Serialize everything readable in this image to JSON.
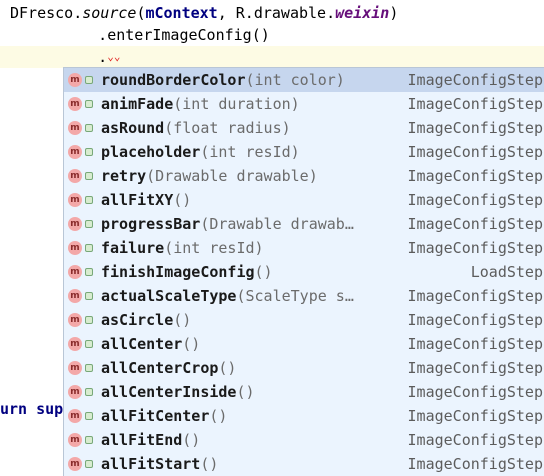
{
  "editor": {
    "line1_obj": "DFresco.",
    "line1_method": "source",
    "line1_open": "(",
    "line1_arg1": "mContext",
    "line1_sep": ", R.drawable.",
    "line1_field": "weixin",
    "line1_close": ")",
    "line2": "      .enterImageConfig()",
    "line3": "      .",
    "fragment": "urn sup"
  },
  "completion": {
    "items": [
      {
        "name": "roundBorderColor",
        "params": "(int color)",
        "type": "ImageConfigStep"
      },
      {
        "name": "animFade",
        "params": "(int duration)",
        "type": "ImageConfigStep"
      },
      {
        "name": "asRound",
        "params": "(float radius)",
        "type": "ImageConfigStep"
      },
      {
        "name": "placeholder",
        "params": "(int resId)",
        "type": "ImageConfigStep"
      },
      {
        "name": "retry",
        "params": "(Drawable drawable)",
        "type": "ImageConfigStep"
      },
      {
        "name": "allFitXY",
        "params": "()",
        "type": "ImageConfigStep"
      },
      {
        "name": "progressBar",
        "params": "(Drawable drawab…",
        "type": "ImageConfigStep"
      },
      {
        "name": "failure",
        "params": "(int resId)",
        "type": "ImageConfigStep"
      },
      {
        "name": "finishImageConfig",
        "params": "()",
        "type": "LoadStep"
      },
      {
        "name": "actualScaleType",
        "params": "(ScaleType s…",
        "type": "ImageConfigStep"
      },
      {
        "name": "asCircle",
        "params": "()",
        "type": "ImageConfigStep"
      },
      {
        "name": "allCenter",
        "params": "()",
        "type": "ImageConfigStep"
      },
      {
        "name": "allCenterCrop",
        "params": "()",
        "type": "ImageConfigStep"
      },
      {
        "name": "allCenterInside",
        "params": "()",
        "type": "ImageConfigStep"
      },
      {
        "name": "allFitCenter",
        "params": "()",
        "type": "ImageConfigStep"
      },
      {
        "name": "allFitEnd",
        "params": "()",
        "type": "ImageConfigStep"
      },
      {
        "name": "allFitStart",
        "params": "()",
        "type": "ImageConfigStep"
      }
    ],
    "method_icon_letter": "m",
    "icons": {
      "kind": "method-icon",
      "access": "lock-icon"
    },
    "selected_index": 0
  }
}
